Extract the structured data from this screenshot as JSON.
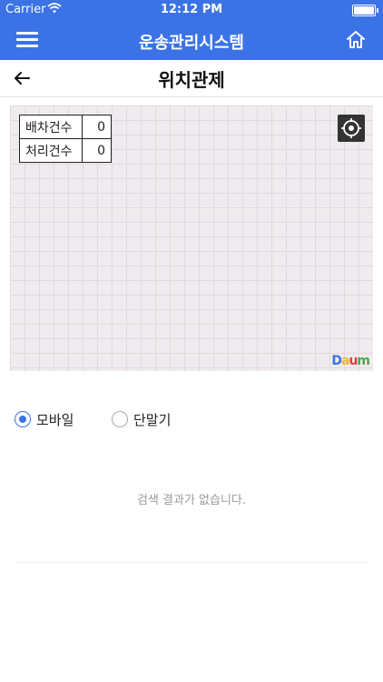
{
  "status_bar": {
    "carrier": "Carrier",
    "time": "12:12 PM"
  },
  "header": {
    "title": "운송관리시스템"
  },
  "sub_header": {
    "title": "위치관제"
  },
  "map": {
    "stats": [
      {
        "label": "배차건수",
        "value": "0"
      },
      {
        "label": "처리건수",
        "value": "0"
      }
    ],
    "logo": {
      "text": "Daum",
      "colors": [
        "#3b73e6",
        "#f2b233",
        "#e33b3b",
        "#4aa84a"
      ]
    }
  },
  "filter": {
    "options": [
      {
        "label": "모바일",
        "selected": true
      },
      {
        "label": "단말기",
        "selected": false
      }
    ]
  },
  "results": {
    "empty_message": "검색 결과가 없습니다."
  },
  "colors": {
    "primary": "#3b73e6",
    "map_bg": "#f0ebee"
  }
}
